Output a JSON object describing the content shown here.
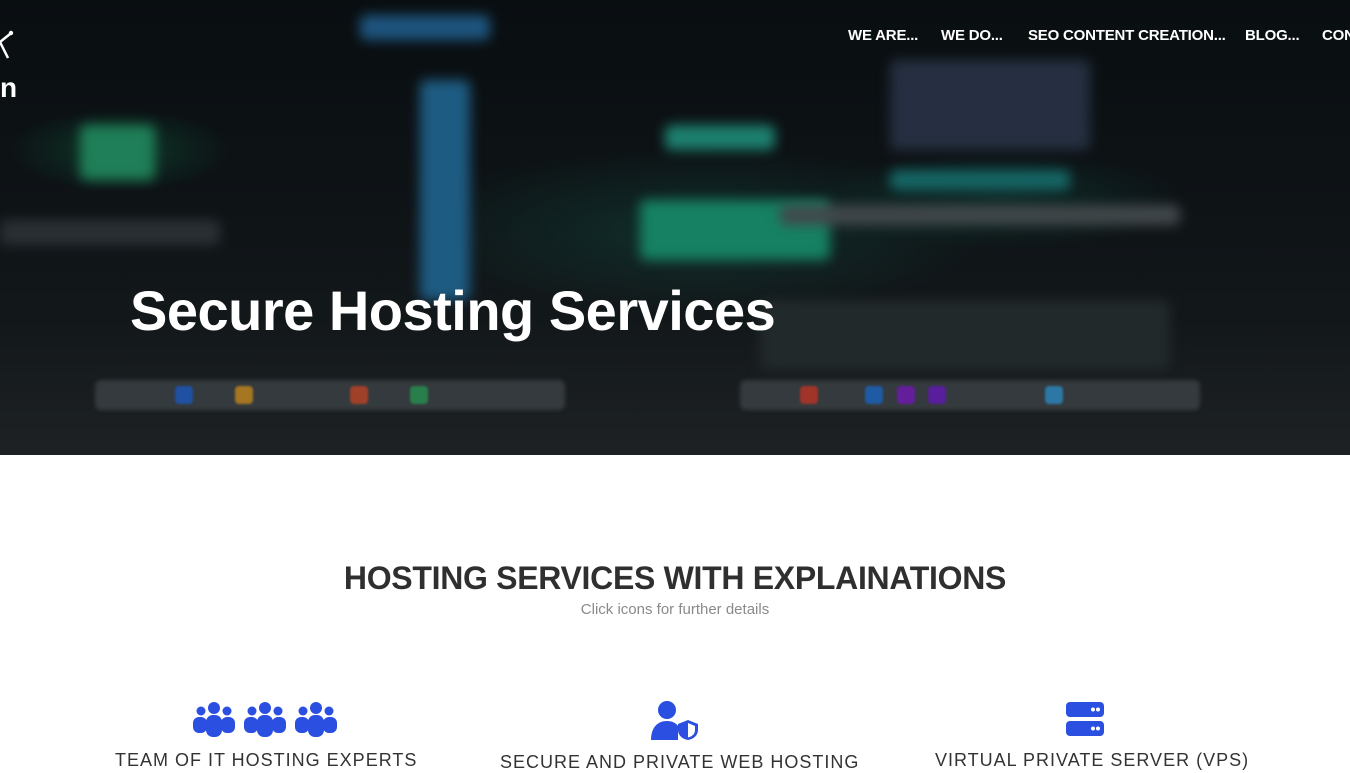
{
  "nav": {
    "items": [
      {
        "label": "WE ARE..."
      },
      {
        "label": "WE DO..."
      },
      {
        "label": "SEO CONTENT CREATION..."
      },
      {
        "label": "BLOG..."
      },
      {
        "label": "CON"
      }
    ]
  },
  "brand": {
    "partial_letter": "n"
  },
  "hero": {
    "title": "Secure Hosting Services"
  },
  "section": {
    "title": "HOSTING SERVICES WITH EXPLAINATIONS",
    "subtitle": "Click icons for further details"
  },
  "features": [
    {
      "icon": "team-icon",
      "label": "TEAM OF IT HOSTING EXPERTS"
    },
    {
      "icon": "user-shield-icon",
      "label": "SECURE AND PRIVATE WEB HOSTING"
    },
    {
      "icon": "server-icon",
      "label": "VIRTUAL PRIVATE SERVER (VPS)"
    }
  ],
  "colors": {
    "accent": "#2b4fe0",
    "heading": "#2f2f2f",
    "subtle": "#8a8a8a"
  }
}
